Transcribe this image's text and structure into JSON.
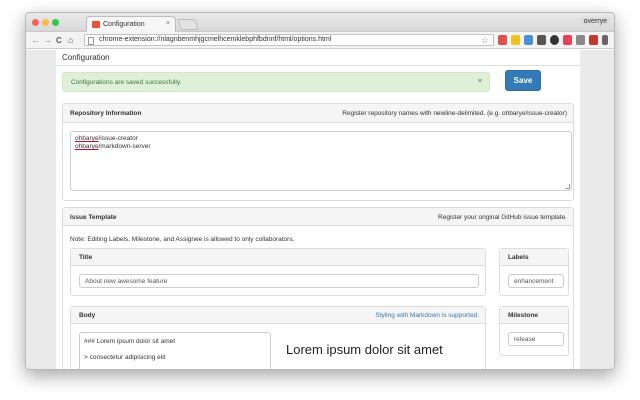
{
  "browser": {
    "tab_title": "Configuration",
    "tab_close": "×",
    "user_name": "overrye",
    "url": "chrome-extension://nlagnbenmhjgcmelhcemklebphfbdnnf/html/options.html",
    "star_glyph": "☆",
    "back_glyph": "←",
    "forward_glyph": "→",
    "reload_glyph": "C",
    "home_glyph": "⌂"
  },
  "page": {
    "title": "Configuration"
  },
  "alert": {
    "message": "Configurations are saved successfully.",
    "close": "×"
  },
  "save_button": {
    "label": "Save"
  },
  "repository": {
    "title": "Repository Information",
    "help": "Register repository names with newline-delimited. (e.g. ohbarye/issue-creator)",
    "lines": [
      {
        "user": "ohbarye",
        "repo": "/issue-creator"
      },
      {
        "user": "ohbarye",
        "repo": "/markdown-server"
      }
    ]
  },
  "issue_template": {
    "title": "Issue Template",
    "help": "Register your original GitHub issue template.",
    "note": "Note: Editing Labels, Milestone, and Assignee is allowed to only collaborators.",
    "title_panel": {
      "label": "Title",
      "value": "About new awesome feature"
    },
    "body_panel": {
      "label": "Body",
      "help": "Styling with Markdown is supported.",
      "text_line1": "### Lorem ipsum dolor sit amet",
      "text_line2": "> consectetur adipisicing elit",
      "preview_heading": "Lorem ipsum dolor sit amet"
    },
    "labels_panel": {
      "label": "Labels",
      "value": "enhancement"
    },
    "milestone_panel": {
      "label": "Milestone",
      "value": "release"
    }
  },
  "colors": {
    "primary": "#337ab7",
    "success_bg": "#dff0d8",
    "success_text": "#3c763d",
    "link": "#337ab7"
  }
}
